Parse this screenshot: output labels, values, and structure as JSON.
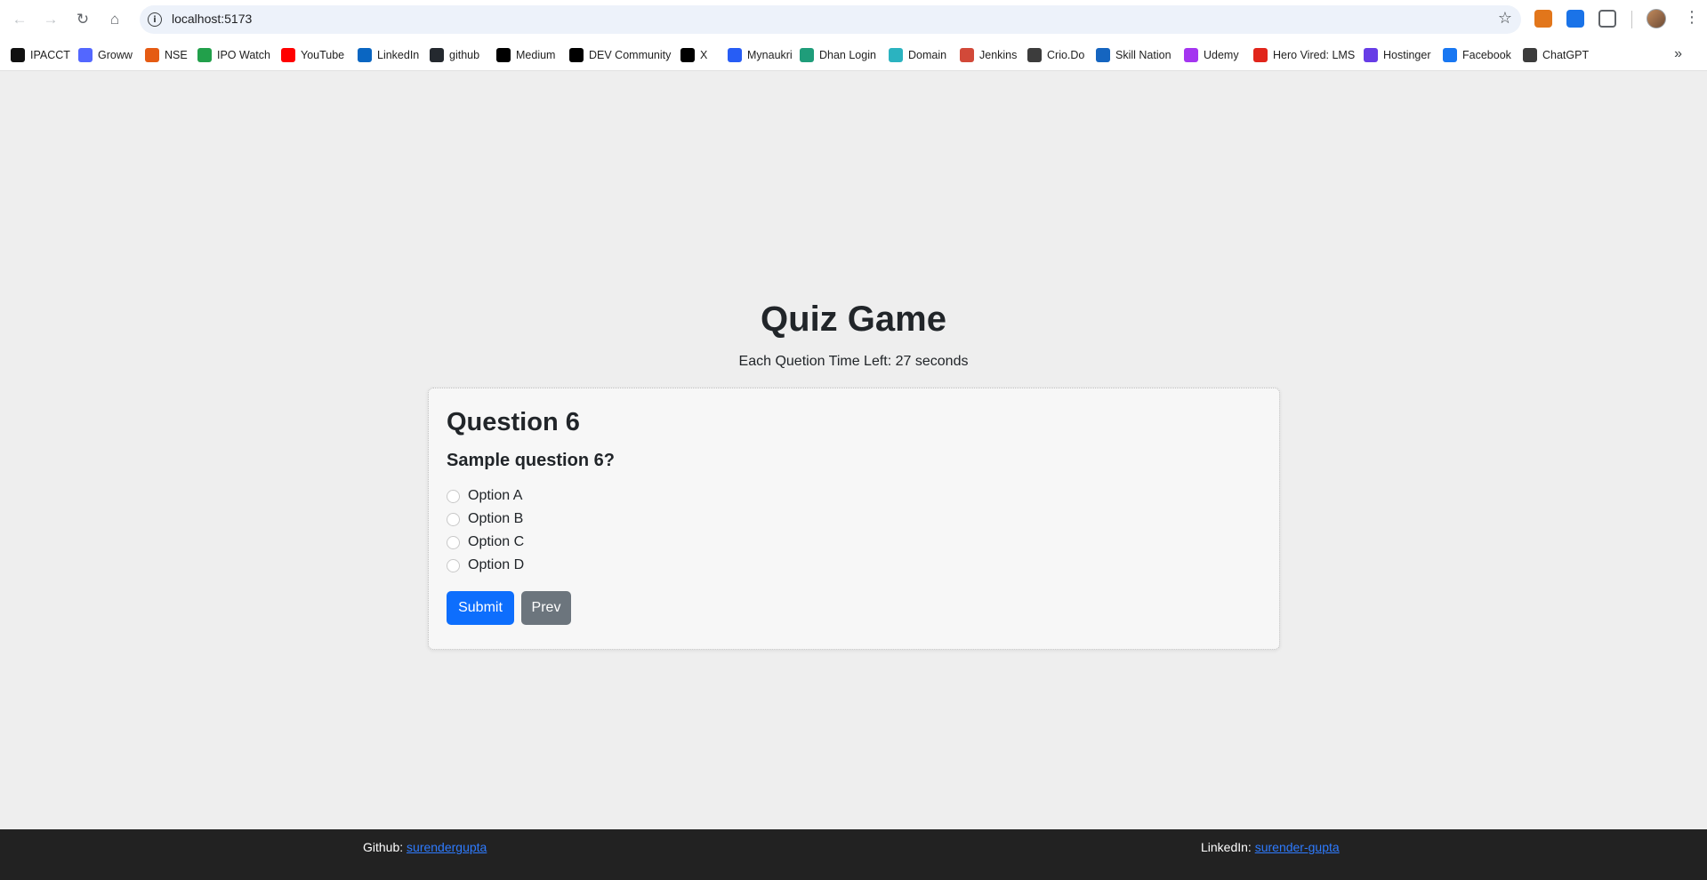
{
  "browser": {
    "url": "localhost:5173",
    "colors": {
      "omnibox_bg": "#edf2fa"
    },
    "bookmarks": [
      {
        "label": "IPACCT",
        "icon": "ipacct-icon",
        "color": "#111111"
      },
      {
        "label": "Groww",
        "icon": "groww-icon",
        "color": "#5367ff"
      },
      {
        "label": "NSE",
        "icon": "nse-icon",
        "color": "#e55b13"
      },
      {
        "label": "IPO Watch",
        "icon": "ipo-watch-icon",
        "color": "#22a04b"
      },
      {
        "label": "YouTube",
        "icon": "youtube-icon",
        "color": "#ff0000"
      },
      {
        "label": "LinkedIn",
        "icon": "linkedin-icon",
        "color": "#0a66c2"
      },
      {
        "label": "github",
        "icon": "github-icon",
        "color": "#24292f"
      },
      {
        "label": "Medium",
        "icon": "medium-icon",
        "color": "#000000"
      },
      {
        "label": "DEV Community",
        "icon": "dev-icon",
        "color": "#000000"
      },
      {
        "label": "X",
        "icon": "x-icon",
        "color": "#000000"
      },
      {
        "label": "Mynaukri",
        "icon": "mynaukri-icon",
        "color": "#275df5"
      },
      {
        "label": "Dhan Login",
        "icon": "dhan-icon",
        "color": "#1f9d7a"
      },
      {
        "label": "Domain",
        "icon": "domain-icon",
        "color": "#2bb3c0"
      },
      {
        "label": "Jenkins",
        "icon": "jenkins-icon",
        "color": "#d24939"
      },
      {
        "label": "Crio.Do",
        "icon": "crio-icon",
        "color": "#3c3c3c"
      },
      {
        "label": "Skill Nation",
        "icon": "skill-nation-icon",
        "color": "#1565c0"
      },
      {
        "label": "Udemy",
        "icon": "udemy-icon",
        "color": "#a435f0"
      },
      {
        "label": "Hero Vired: LMS",
        "icon": "hero-vired-icon",
        "color": "#e1251b"
      },
      {
        "label": "Hostinger",
        "icon": "hostinger-icon",
        "color": "#673de6"
      },
      {
        "label": "Facebook",
        "icon": "facebook-icon",
        "color": "#1877f2"
      },
      {
        "label": "ChatGPT",
        "icon": "chatgpt-icon",
        "color": "#3c3c3c"
      }
    ]
  },
  "page": {
    "title": "Quiz Game",
    "timer_text": "Each Quetion Time Left: 27 seconds"
  },
  "question": {
    "heading": "Question 6",
    "text": "Sample question 6?",
    "options": [
      "Option A",
      "Option B",
      "Option C",
      "Option D"
    ],
    "submit_label": "Submit",
    "prev_label": "Prev"
  },
  "footer": {
    "github_label": "Github:",
    "github_link": "surendergupta",
    "linkedin_label": "LinkedIn:",
    "linkedin_link": "surender-gupta"
  }
}
